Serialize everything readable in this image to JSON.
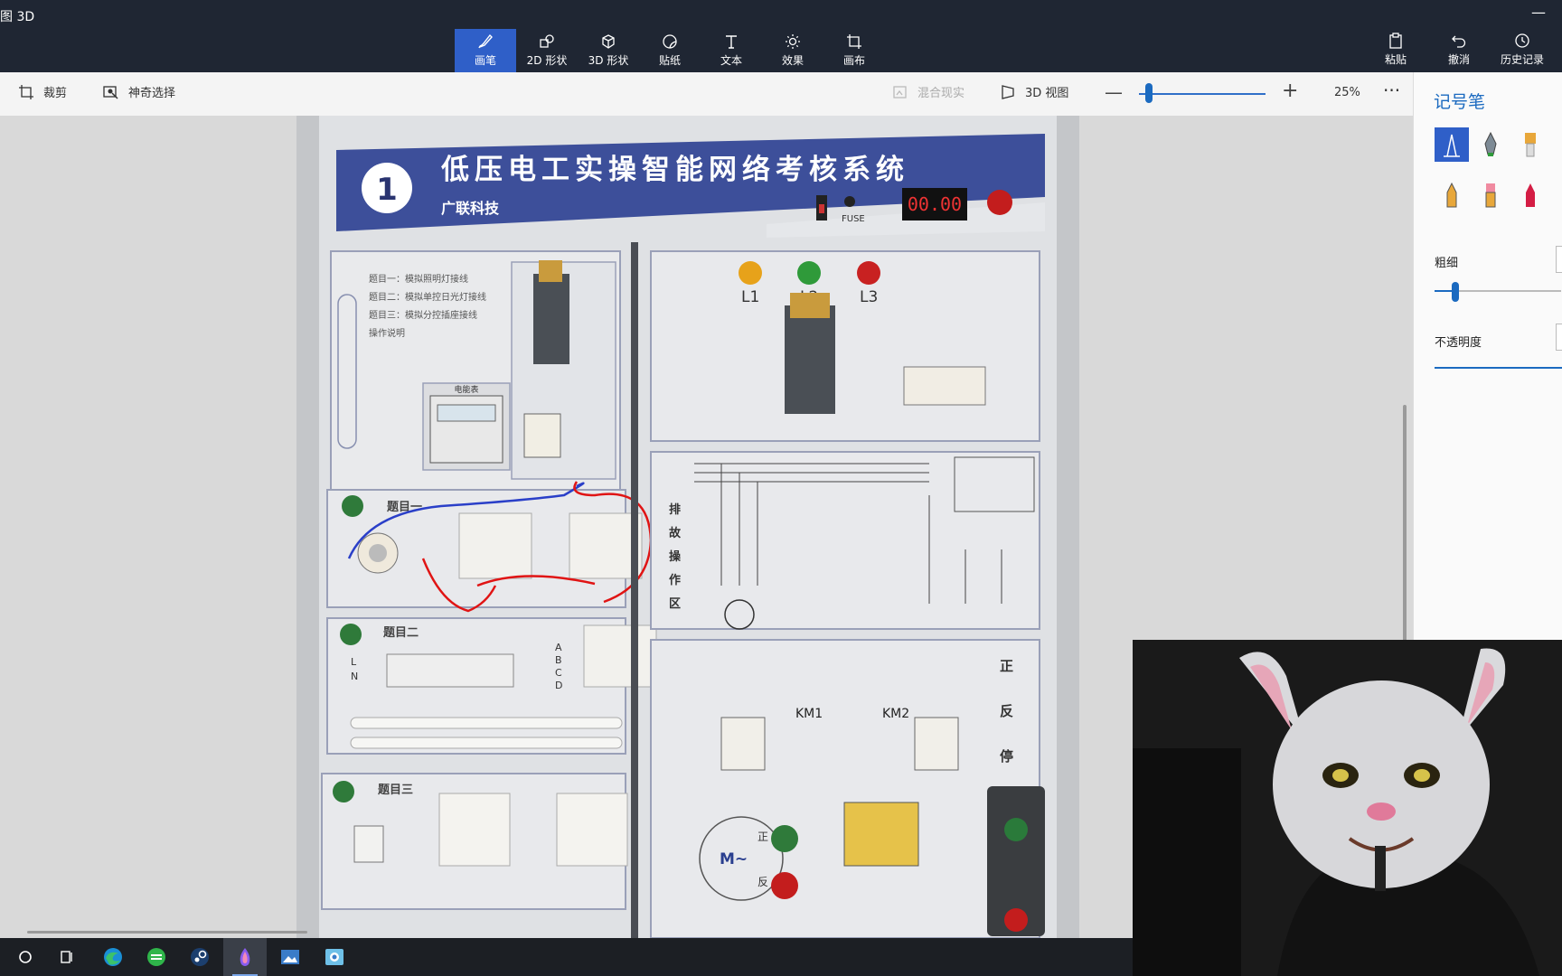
{
  "app": {
    "title": "图 3D"
  },
  "ribbon": {
    "tools": [
      {
        "label": "画笔",
        "icon": "brush-icon",
        "active": true
      },
      {
        "label": "2D 形状",
        "icon": "shapes-2d-icon"
      },
      {
        "label": "3D 形状",
        "icon": "cube-icon"
      },
      {
        "label": "贴纸",
        "icon": "sticker-icon"
      },
      {
        "label": "文本",
        "icon": "text-icon"
      },
      {
        "label": "效果",
        "icon": "sun-icon"
      },
      {
        "label": "画布",
        "icon": "canvas-icon"
      }
    ],
    "right_tools": [
      {
        "label": "粘贴",
        "icon": "paste-icon"
      },
      {
        "label": "撤消",
        "icon": "undo-icon"
      },
      {
        "label": "历史记录",
        "icon": "history-icon"
      }
    ]
  },
  "subbar": {
    "crop": "裁剪",
    "magic_select": "神奇选择",
    "mixed_reality": "混合现实",
    "view_3d": "3D 视图",
    "zoom": "25%"
  },
  "panel": {
    "title": "记号笔",
    "thickness_label": "粗细",
    "opacity_label": "不透明度",
    "brushes": [
      "marker-icon",
      "calligraphy-pen-icon",
      "oil-brush-icon",
      "pencil-icon",
      "eraser-icon",
      "crayon-icon"
    ]
  },
  "board": {
    "number": "1",
    "title": "低压电工实操智能网络考核系统",
    "company": "广联科技",
    "display": "00.00",
    "fuse": "FUSE",
    "lights": [
      "L1",
      "L2",
      "L3"
    ],
    "km": [
      "KM1",
      "KM2"
    ],
    "zone": [
      "排",
      "故",
      "操",
      "作",
      "区"
    ],
    "topics": [
      "题目一",
      "题目二",
      "题目三"
    ],
    "side_labels_right": [
      "正",
      "反",
      "停"
    ],
    "abcd": [
      "A",
      "B",
      "C",
      "D"
    ],
    "ln": [
      "L",
      "N"
    ],
    "meter_label": "电能表",
    "motor_m": "M~",
    "ctrl_zheng": "正",
    "ctrl_fan": "反"
  },
  "colors": {
    "accent": "#2f5fc8",
    "ribbon_bg": "#1f2633",
    "board_header": "#3d4f9a"
  },
  "taskbar": {
    "items": [
      "start-icon",
      "task-view-icon",
      "edge-icon",
      "green-app-icon",
      "steam-icon",
      "paint3d-icon",
      "photos-icon",
      "capture-icon"
    ]
  }
}
